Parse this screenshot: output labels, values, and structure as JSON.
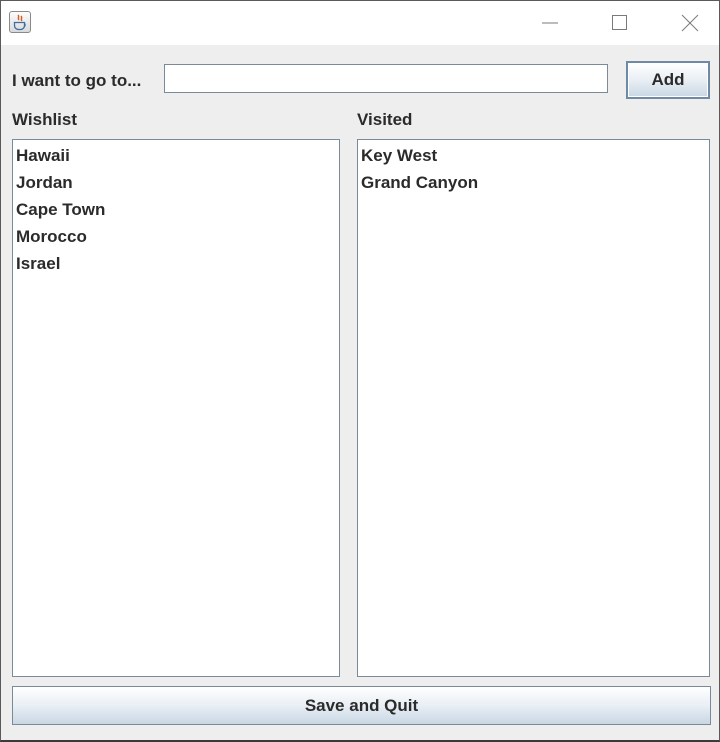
{
  "window": {
    "app_icon": "java-icon",
    "controls": [
      "minimize-icon",
      "maximize-icon",
      "close-icon"
    ]
  },
  "form": {
    "prompt_label": "I want to go to...",
    "destination_value": "",
    "add_label": "Add"
  },
  "wishlist": {
    "title": "Wishlist",
    "items": [
      "Hawaii",
      "Jordan",
      "Cape Town",
      "Morocco",
      "Israel"
    ]
  },
  "visited": {
    "title": "Visited",
    "items": [
      "Key West",
      "Grand Canyon"
    ]
  },
  "footer": {
    "save_label": "Save and Quit"
  }
}
